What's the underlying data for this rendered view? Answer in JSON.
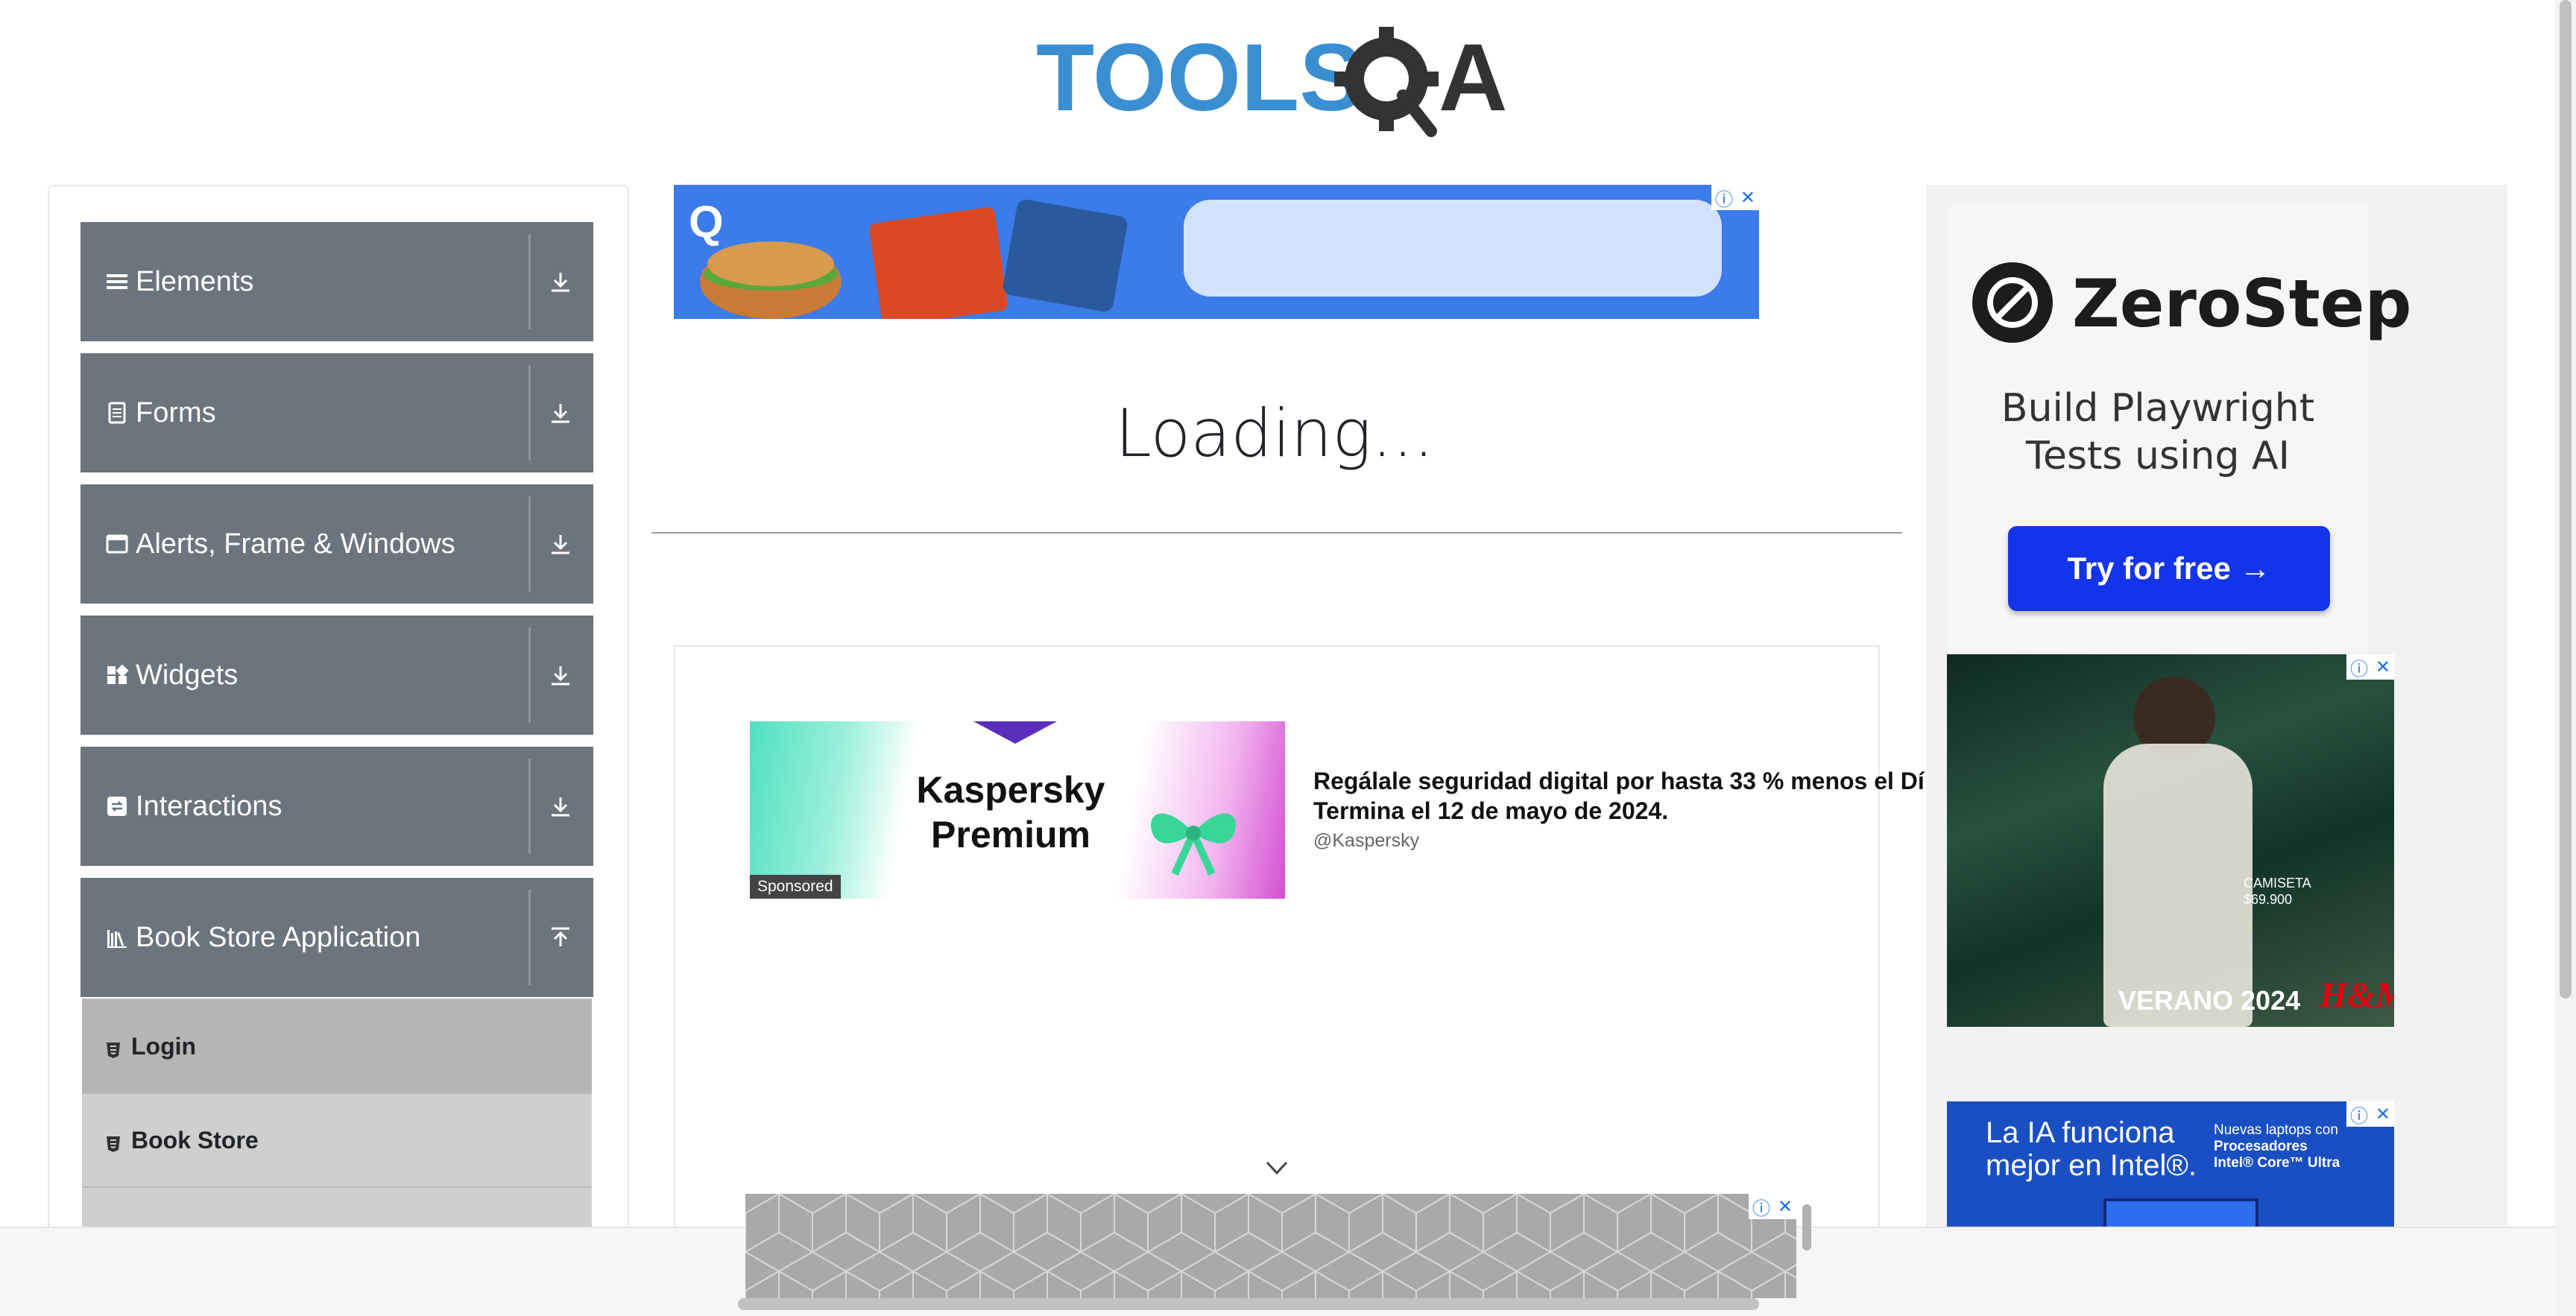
{
  "header": {
    "logo_text": "TOOLSQA"
  },
  "sidebar": {
    "groups": [
      {
        "label": "Elements",
        "icon": "hamburger-icon",
        "arrow": "download-arrow-icon"
      },
      {
        "label": "Forms",
        "icon": "form-icon",
        "arrow": "download-arrow-icon"
      },
      {
        "label": "Alerts, Frame & Windows",
        "icon": "window-icon",
        "arrow": "download-arrow-icon"
      },
      {
        "label": "Widgets",
        "icon": "widgets-icon",
        "arrow": "download-arrow-icon"
      },
      {
        "label": "Interactions",
        "icon": "interactions-icon",
        "arrow": "download-arrow-icon"
      },
      {
        "label": "Book Store Application",
        "icon": "books-icon",
        "arrow": "upload-arrow-icon"
      }
    ],
    "sub_items": [
      {
        "label": "Login",
        "active": true
      },
      {
        "label": "Book Store",
        "active": false
      }
    ]
  },
  "main": {
    "loading_text": "Loading...",
    "sponsored_ad": {
      "brand_line1": "Kaspersky",
      "brand_line2": "Premium",
      "badge": "Sponsored",
      "headline": "Regálale seguridad digital por hasta 33 % menos el Dí",
      "subline": "Termina el 12 de mayo de 2024.",
      "handle": "@Kaspersky"
    }
  },
  "right_ads": {
    "zerostep": {
      "name": "ZeroStep",
      "tagline_line1": "Build Playwright",
      "tagline_line2": "Tests using AI",
      "cta": "Try for free →"
    },
    "hm": {
      "price_line1": "CAMISETA",
      "price_line2": "$69.900",
      "summer": "VERANO 2024",
      "brand": "H&M"
    },
    "intel": {
      "main_line1": "La IA funciona",
      "main_line2": "mejor en Intel®.",
      "side_line1": "Nuevas laptops con",
      "side_line2": "Procesadores",
      "side_line3": "Intel® Core™ Ultra"
    }
  },
  "colors": {
    "sidebar_header": "#6c757d",
    "sub_item": "#cfcfcf",
    "sub_item_active": "#b5b5b5",
    "logo_blue": "#3b8ed2",
    "logo_dark": "#333333",
    "zerostep_cta": "#1434ea"
  }
}
